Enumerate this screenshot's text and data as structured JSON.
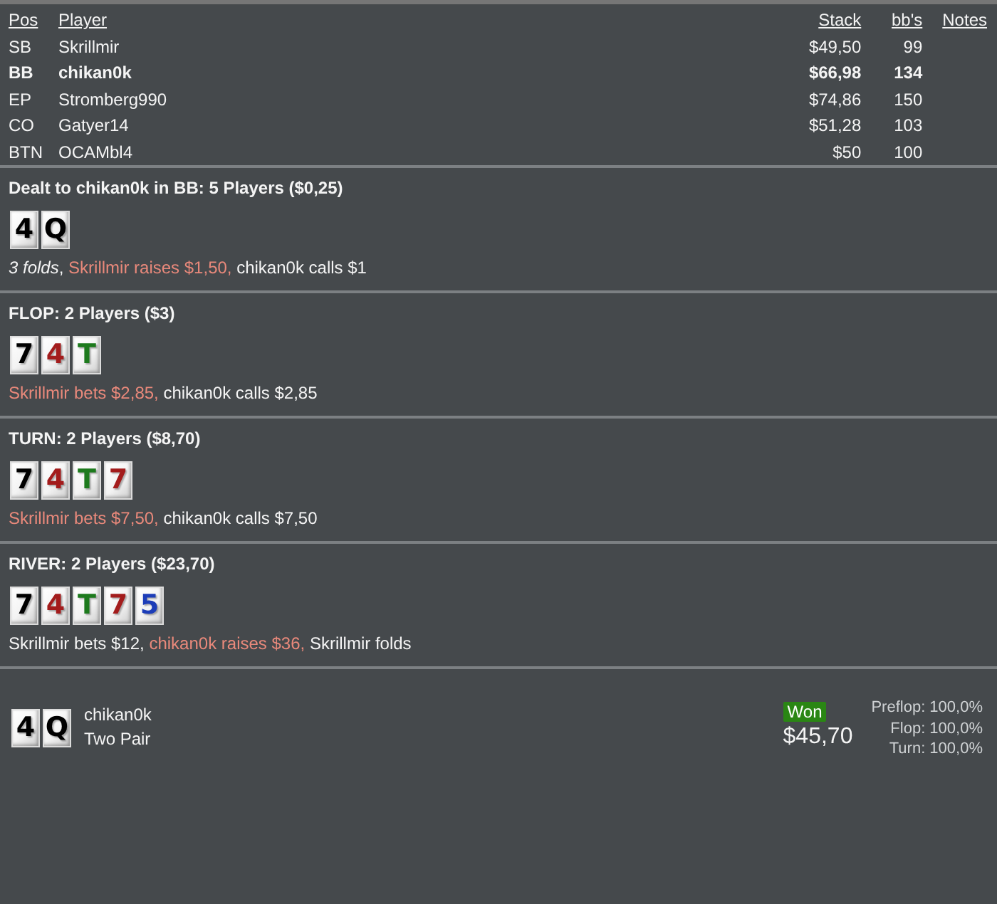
{
  "players": {
    "columns": [
      "Pos",
      "Player",
      "Stack",
      "bb's",
      "Notes"
    ],
    "rows": [
      {
        "position": "SB",
        "name": "Skrillmir",
        "stack": "$49,50",
        "bbs": "99",
        "hero": false
      },
      {
        "position": "BB",
        "name": "chikan0k",
        "stack": "$66,98",
        "bbs": "134",
        "hero": true
      },
      {
        "position": "EP",
        "name": "Stromberg990",
        "stack": "$74,86",
        "bbs": "150",
        "hero": false
      },
      {
        "position": "CO",
        "name": "Gatyer14",
        "stack": "$51,28",
        "bbs": "103",
        "hero": false
      },
      {
        "position": "BTN",
        "name": "OCAMbl4",
        "stack": "$50",
        "bbs": "100",
        "hero": false
      }
    ]
  },
  "streets": [
    {
      "title": "Dealt to chikan0k in BB: 5 Players ($0,25)",
      "cards": [
        {
          "rank": "4",
          "color": "#000000"
        },
        {
          "rank": "Q",
          "color": "#000000"
        }
      ],
      "actions": [
        {
          "text": "*3 folds*,",
          "kind": "plain"
        },
        {
          "text": "Skrillmir raises $1,50,",
          "kind": "highlight"
        },
        {
          "text": "chikan0k calls $1",
          "kind": "plain"
        }
      ]
    },
    {
      "title": "FLOP: 2 Players ($3)",
      "cards": [
        {
          "rank": "7",
          "color": "#000000"
        },
        {
          "rank": "4",
          "color": "#a31c1c"
        },
        {
          "rank": "T",
          "color": "#1d7a1d"
        }
      ],
      "actions": [
        {
          "text": "Skrillmir bets $2,85,",
          "kind": "highlight"
        },
        {
          "text": "chikan0k calls $2,85",
          "kind": "plain"
        }
      ]
    },
    {
      "title": "TURN: 2 Players ($8,70)",
      "cards": [
        {
          "rank": "7",
          "color": "#000000"
        },
        {
          "rank": "4",
          "color": "#a31c1c"
        },
        {
          "rank": "T",
          "color": "#1d7a1d"
        },
        {
          "rank": "7",
          "color": "#a31c1c"
        }
      ],
      "actions": [
        {
          "text": "Skrillmir bets $7,50,",
          "kind": "highlight"
        },
        {
          "text": "chikan0k calls $7,50",
          "kind": "plain"
        }
      ]
    },
    {
      "title": "RIVER: 2 Players ($23,70)",
      "cards": [
        {
          "rank": "7",
          "color": "#000000"
        },
        {
          "rank": "4",
          "color": "#a31c1c"
        },
        {
          "rank": "T",
          "color": "#1d7a1d"
        },
        {
          "rank": "7",
          "color": "#a31c1c"
        },
        {
          "rank": "5",
          "color": "#1c3db8"
        }
      ],
      "actions": [
        {
          "text": "Skrillmir bets $12,",
          "kind": "plain"
        },
        {
          "text": "chikan0k raises $36,",
          "kind": "highlight"
        },
        {
          "text": "Skrillmir folds",
          "kind": "plain"
        }
      ]
    }
  ],
  "result": {
    "cards": [
      {
        "rank": "4",
        "color": "#000000"
      },
      {
        "rank": "Q",
        "color": "#000000"
      }
    ],
    "player": "chikan0k",
    "hand": "Two Pair",
    "outcome": "Won",
    "amount": "$45,70",
    "equity": [
      "Preflop: 100,0%",
      "Flop: 100,0%",
      "Turn: 100,0%"
    ]
  }
}
